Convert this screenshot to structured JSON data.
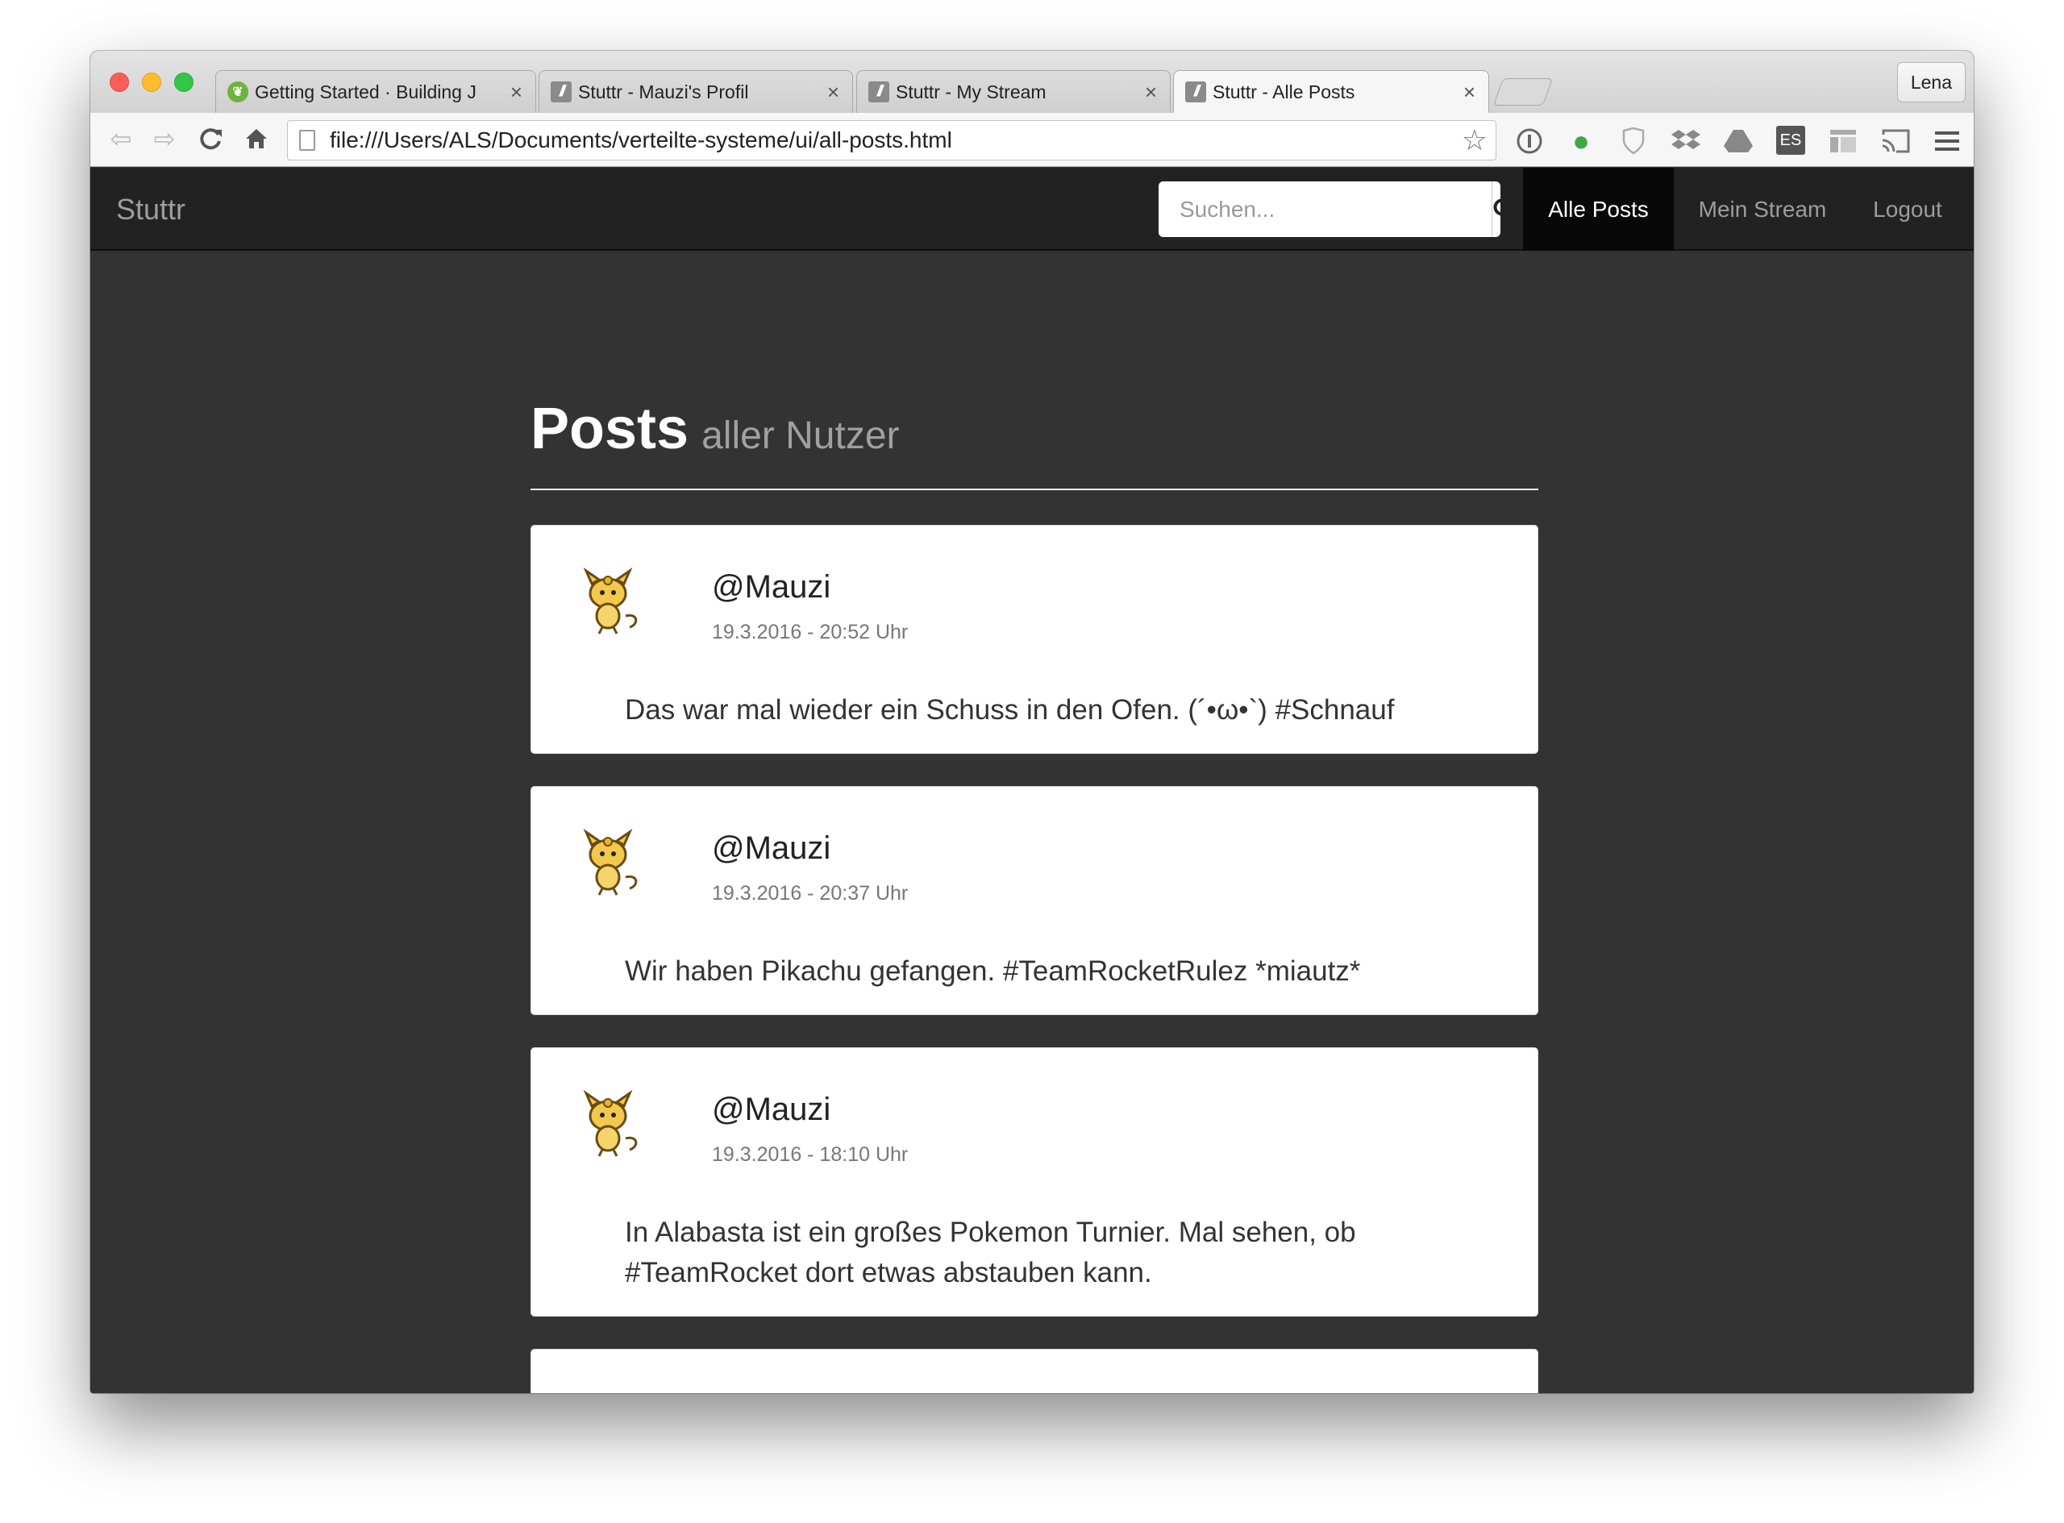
{
  "browser": {
    "tabs": [
      {
        "title": "Getting Started · Building J",
        "favicon": "spring-leaf-icon",
        "active": false
      },
      {
        "title": "Stuttr - Mauzi's Profil",
        "favicon": "slash-icon",
        "active": false
      },
      {
        "title": "Stuttr - My Stream",
        "favicon": "slash-icon",
        "active": false
      },
      {
        "title": "Stuttr - Alle Posts",
        "favicon": "slash-icon",
        "active": true
      }
    ],
    "close_glyph": "×",
    "profile_name": "Lena",
    "url": "file:///Users/ALS/Documents/verteilte-systeme/ui/all-posts.html",
    "extensions": [
      "onepassword-icon",
      "evernote-icon",
      "ghostery-icon",
      "dropbox-icon",
      "google-drive-icon",
      "es-icon",
      "reader-icon",
      "cast-icon",
      "menu-icon"
    ],
    "es_label": "ES"
  },
  "app": {
    "brand": "Stuttr",
    "search_placeholder": "Suchen...",
    "nav": [
      {
        "label": "Alle Posts",
        "active": true
      },
      {
        "label": "Mein Stream",
        "active": false
      },
      {
        "label": "Logout",
        "active": false
      }
    ],
    "colors": {
      "navbar": "#222222",
      "background": "#333333",
      "active_nav": "#080808"
    }
  },
  "page": {
    "title": "Posts",
    "subtitle": "aller Nutzer"
  },
  "posts": [
    {
      "user": "@Mauzi",
      "time": "19.3.2016 - 20:52 Uhr",
      "text": "Das war mal wieder ein Schuss in den Ofen. (´•ω•`) #Schnauf"
    },
    {
      "user": "@Mauzi",
      "time": "19.3.2016 - 20:37 Uhr",
      "text": "Wir haben Pikachu gefangen. #TeamRocketRulez *miautz*"
    },
    {
      "user": "@Mauzi",
      "time": "19.3.2016 - 18:10 Uhr",
      "text": "In Alabasta ist ein großes Pokemon Turnier. Mal sehen, ob #TeamRocket dort etwas abstauben kann."
    }
  ]
}
